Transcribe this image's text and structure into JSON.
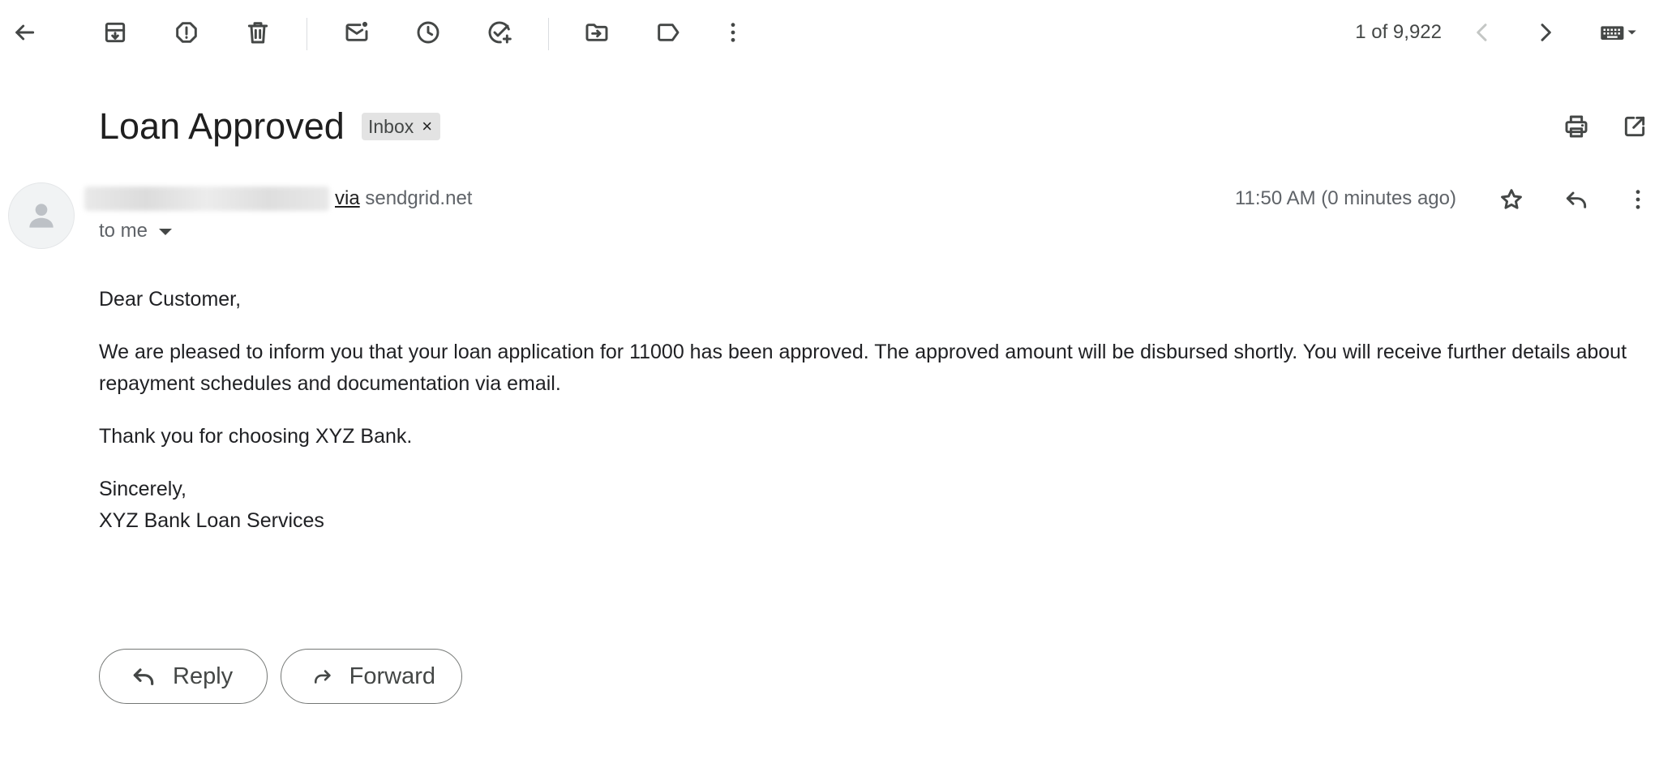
{
  "toolbar": {
    "counter_text": "1 of 9,922",
    "icons": [
      "back-arrow-icon",
      "archive-icon",
      "report-spam-icon",
      "delete-icon",
      "mark-unread-icon",
      "snooze-icon",
      "add-task-icon",
      "move-to-icon",
      "label-icon",
      "more-vert-icon",
      "prev-chevron-icon",
      "next-chevron-icon",
      "keyboard-icon"
    ]
  },
  "email": {
    "subject": "Loan Approved",
    "label_chip": "Inbox",
    "label_remove": "×",
    "via_word": "via",
    "via_domain": "sendgrid.net",
    "recipient_text": "to me",
    "timestamp": "11:50 AM (0 minutes ago)",
    "body": {
      "greeting": "Dear Customer,",
      "paragraph": "We are pleased to inform you that your loan application for 11000 has been approved. The approved amount will be disbursed shortly. You will receive further details about repayment schedules and documentation via email.",
      "thanks": "Thank you for choosing XYZ Bank.",
      "closing": "Sincerely,",
      "signature": "XYZ Bank Loan Services"
    }
  },
  "actions": {
    "reply_label": "Reply",
    "forward_label": "Forward"
  },
  "colors": {
    "icon": "#444746",
    "chip_bg": "#e3e3e3",
    "text_primary": "#1f1f1f",
    "text_secondary": "#5f6368"
  }
}
